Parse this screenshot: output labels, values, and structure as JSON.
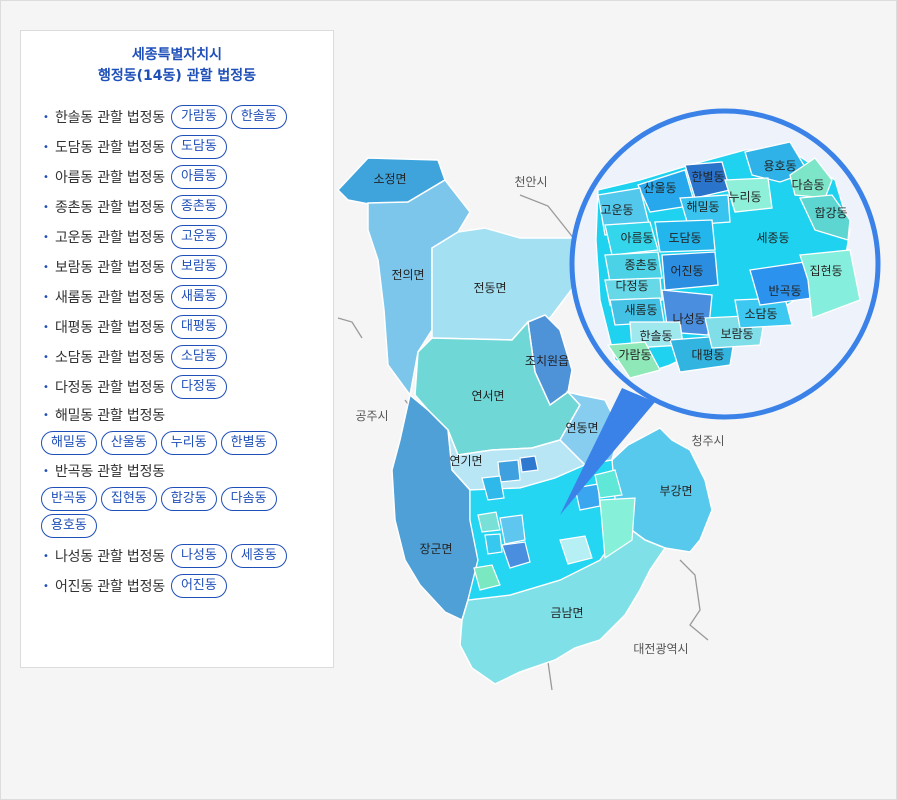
{
  "panel": {
    "title_line1": "세종특별자치시",
    "title_line2": "행정동(14동) 관할 법정동",
    "items": [
      {
        "label": "한솔동 관할 법정동",
        "chips": [
          "가람동",
          "한솔동"
        ]
      },
      {
        "label": "도담동 관할 법정동",
        "chips": [
          "도담동"
        ]
      },
      {
        "label": "아름동 관할 법정동",
        "chips": [
          "아름동"
        ]
      },
      {
        "label": "종촌동 관할 법정동",
        "chips": [
          "종촌동"
        ]
      },
      {
        "label": "고운동 관할 법정동",
        "chips": [
          "고운동"
        ]
      },
      {
        "label": "보람동 관할 법정동",
        "chips": [
          "보람동"
        ]
      },
      {
        "label": "새롬동 관할 법정동",
        "chips": [
          "새롬동"
        ]
      },
      {
        "label": "대평동 관할 법정동",
        "chips": [
          "대평동"
        ]
      },
      {
        "label": "소담동 관할 법정동",
        "chips": [
          "소담동"
        ]
      },
      {
        "label": "다정동 관할 법정동",
        "chips": [
          "다정동"
        ]
      },
      {
        "label": "해밀동 관할 법정동",
        "chips": [
          "해밀동",
          "산울동",
          "누리동",
          "한별동"
        ]
      },
      {
        "label": "반곡동 관할 법정동",
        "chips": [
          "반곡동",
          "집현동",
          "합강동",
          "다솜동",
          "용호동"
        ]
      },
      {
        "label": "나성동 관할 법정동",
        "chips": [
          "나성동",
          "세종동"
        ]
      },
      {
        "label": "어진동 관할 법정동",
        "chips": [
          "어진동"
        ]
      }
    ]
  },
  "map": {
    "regions": {
      "sojeong": "소정면",
      "jeonui": "전의면",
      "jeondong": "전동면",
      "jochiwon": "조치원읍",
      "yeonseo": "연서면",
      "yeondong": "연동면",
      "yeongi": "연기면",
      "janggun": "장군면",
      "bugang": "부강면",
      "geumnam": "금남면"
    },
    "outside": {
      "cheonan": "천안시",
      "gongju": "공주시",
      "cheongju": "청주시",
      "daejeon": "대전광역시"
    },
    "inset": {
      "sanul": "산울동",
      "hanbyeol": "한별동",
      "yongho": "용호동",
      "dasom": "다솜동",
      "nuri": "누리동",
      "gowoon": "고운동",
      "haemil": "해밀동",
      "hapgang": "합강동",
      "areum": "아름동",
      "dodam": "도담동",
      "sejong": "세종동",
      "jongchon": "종촌동",
      "eojin": "어진동",
      "jiphyeon": "집현동",
      "dajeong": "다정동",
      "bangok": "반곡동",
      "saerom": "새롬동",
      "naseong": "나성동",
      "sodam": "소담동",
      "hansol": "한솔동",
      "boram": "보람동",
      "garam": "가람동",
      "daepyeong": "대평동"
    },
    "colors": {
      "accent": "#1f4fb8",
      "circle_border": "#3a82e8",
      "sejong_main": "#1fd3f0"
    }
  }
}
